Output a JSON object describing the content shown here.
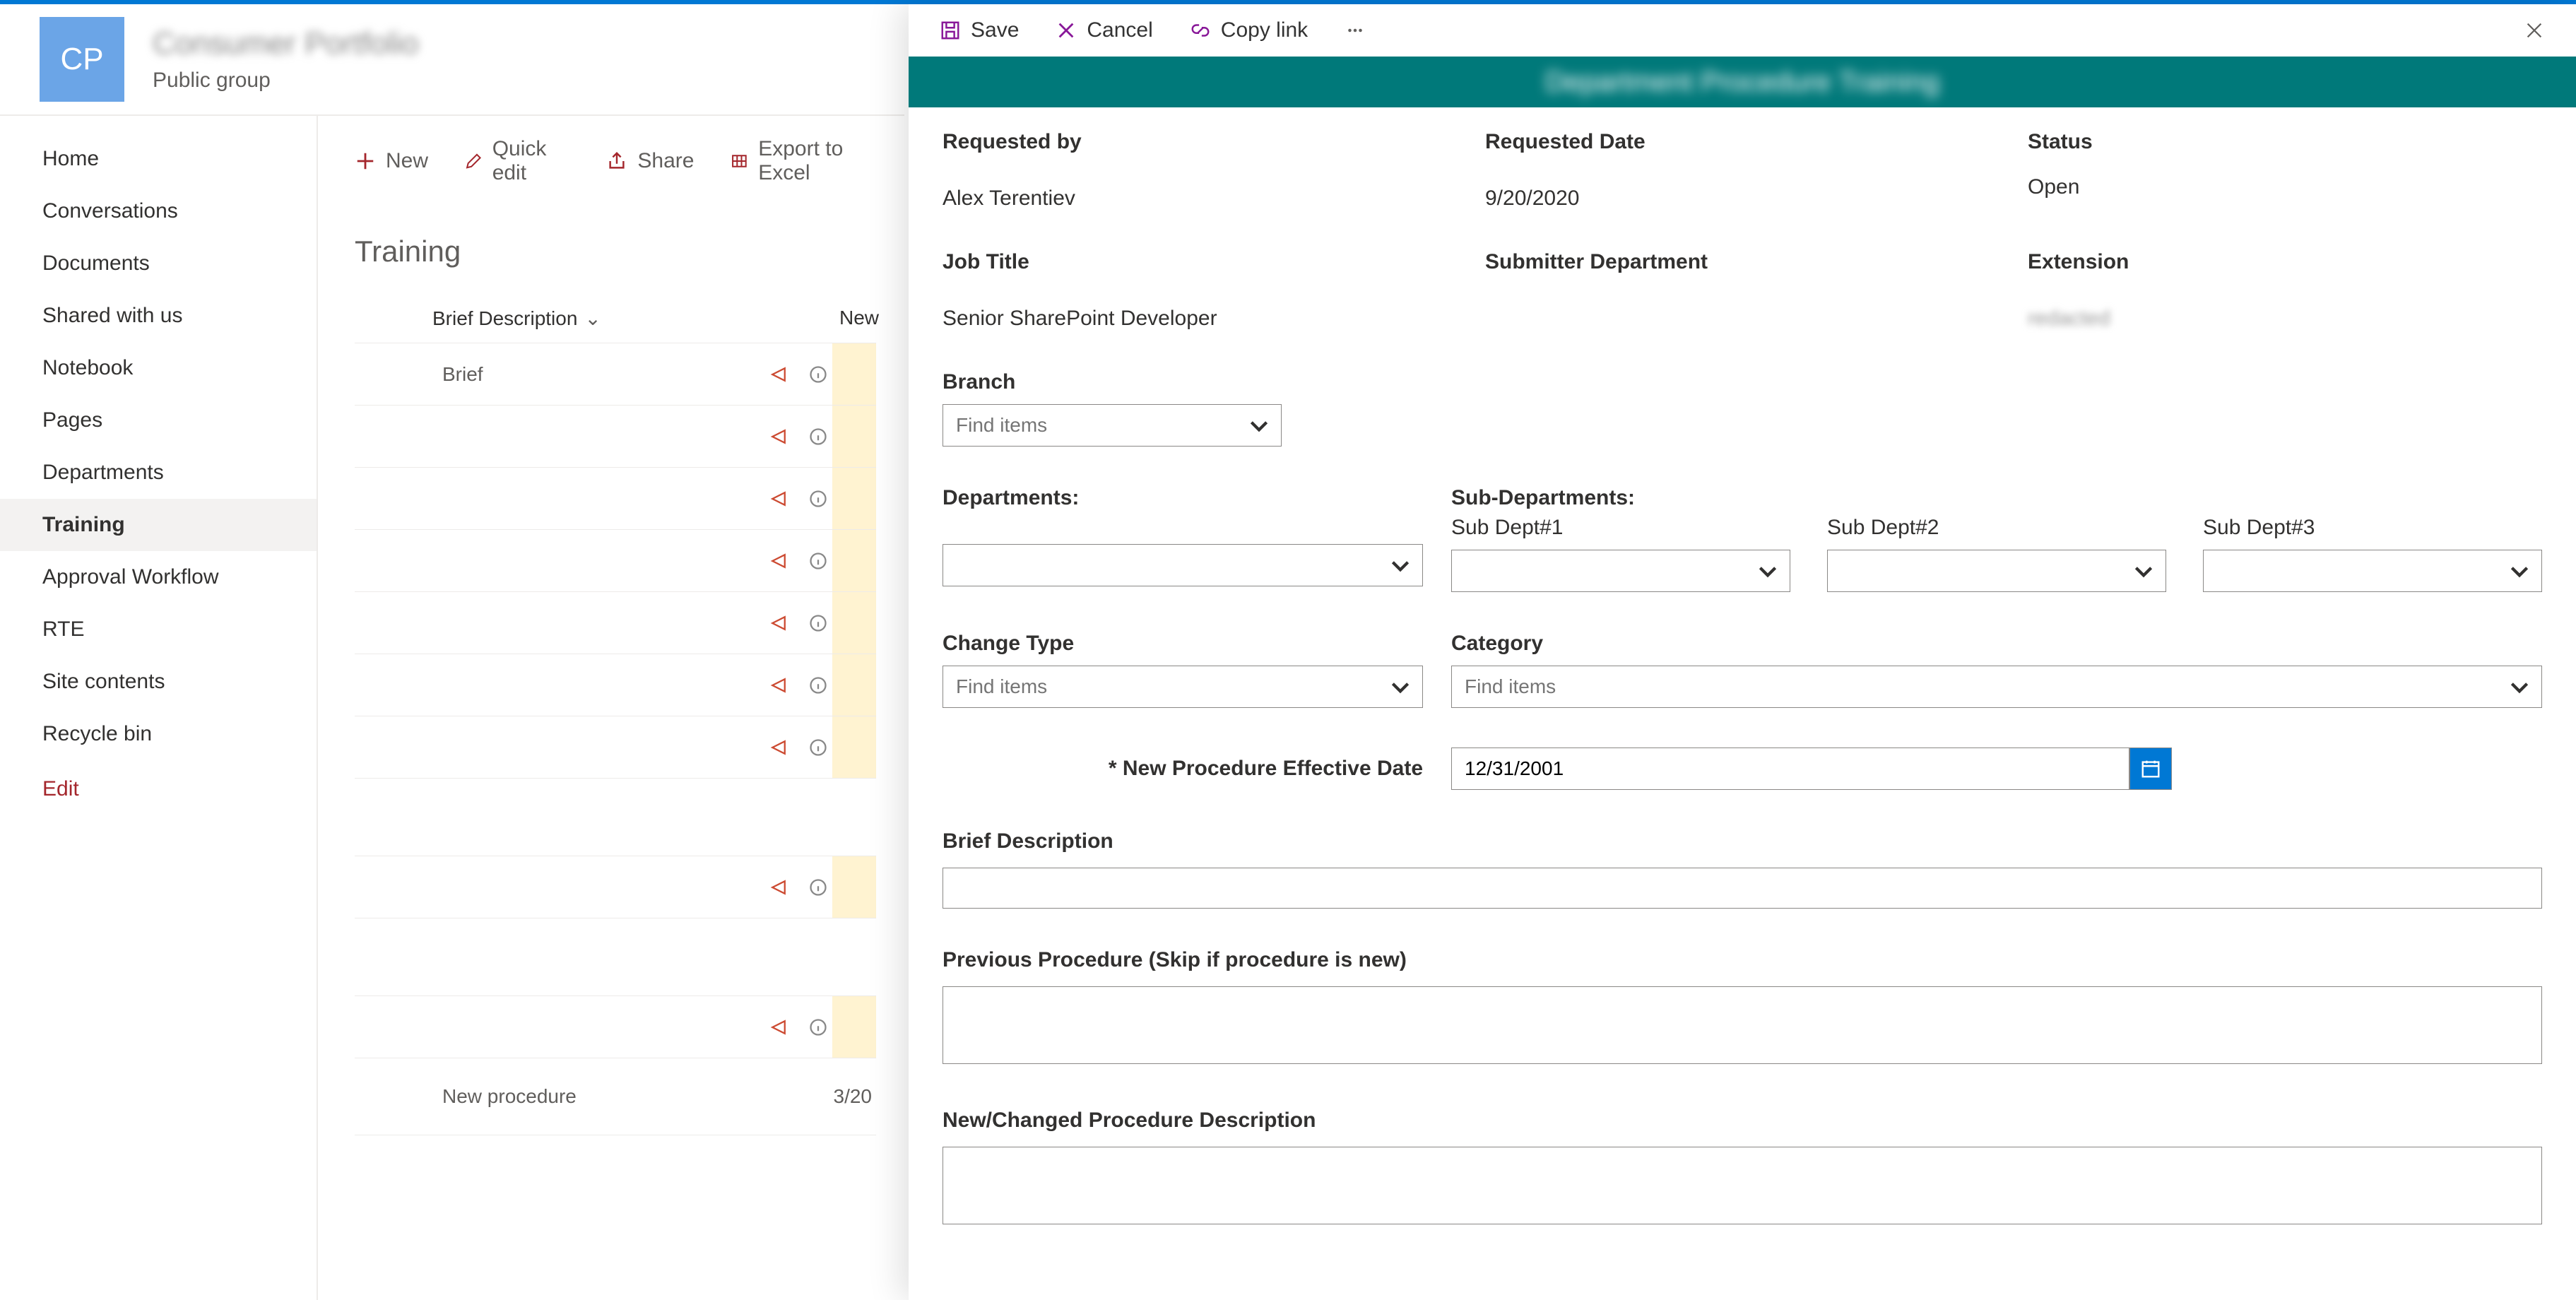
{
  "header": {
    "avatar": "CP",
    "title": "Consumer Portfolio",
    "subtitle": "Public group"
  },
  "sidenav": {
    "items": [
      "Home",
      "Conversations",
      "Documents",
      "Shared with us",
      "Notebook",
      "Pages",
      "Departments",
      "Training",
      "Approval Workflow",
      "RTE",
      "Site contents",
      "Recycle bin"
    ],
    "edit": "Edit",
    "selected": "Training"
  },
  "toolbar": {
    "new_": "New",
    "quick_edit": "Quick edit",
    "share": "Share",
    "export": "Export to Excel"
  },
  "list": {
    "title": "Training",
    "col1": "Brief Description",
    "col2": "New",
    "rows": {
      "r0": "Brief",
      "r11": "New procedure",
      "d11": "3/20"
    }
  },
  "panel": {
    "actions": {
      "save": "Save",
      "cancel": "Cancel",
      "copylink": "Copy link"
    },
    "banner": "Department Procedure Training",
    "fields": {
      "req_by_l": "Requested by",
      "req_by_v": "Alex Terentiev",
      "req_date_l": "Requested Date",
      "req_date_v": "9/20/2020",
      "status_l": "Status",
      "status_v": "Open",
      "job_l": "Job Title",
      "job_v": "Senior SharePoint Developer",
      "subdept_l": "Submitter Department",
      "ext_l": "Extension",
      "ext_v": "redacted",
      "branch_l": "Branch",
      "find": "Find items",
      "dept_l": "Departments:",
      "subdepts_l": "Sub-Departments:",
      "sd1": "Sub Dept#1",
      "sd2": "Sub Dept#2",
      "sd3": "Sub Dept#3",
      "change_l": "Change Type",
      "cat_l": "Category",
      "eff_l": "New Procedure Effective Date",
      "eff_v": "12/31/2001",
      "brief_l": "Brief Description",
      "prev_l": "Previous Procedure (Skip if procedure is new)",
      "newdesc_l": "New/Changed Procedure Description"
    }
  }
}
